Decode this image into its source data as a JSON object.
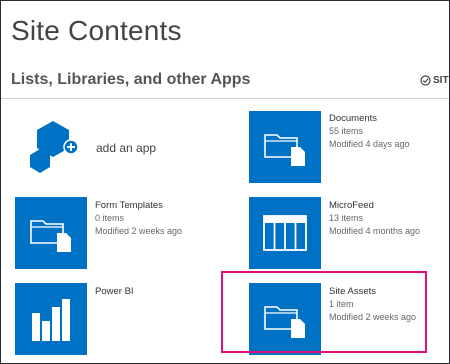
{
  "header": {
    "title": "Site Contents"
  },
  "section": {
    "title": "Lists, Libraries, and other Apps"
  },
  "settings": {
    "label": "SIT",
    "icon": "settings-check-icon"
  },
  "add_app": {
    "label": "add an app",
    "icon": "add-app-icon"
  },
  "apps": [
    {
      "name": "Documents",
      "items": "55 items",
      "modified": "Modified 4 days ago",
      "icon": "folder-document-icon"
    },
    {
      "name": "Form Templates",
      "items": "0 items",
      "modified": "Modified 2 weeks ago",
      "icon": "folder-document-icon"
    },
    {
      "name": "MicroFeed",
      "items": "13 items",
      "modified": "Modified 4 months ago",
      "icon": "list-table-icon"
    },
    {
      "name": "Power BI",
      "items": "",
      "modified": "",
      "icon": "bar-chart-icon"
    },
    {
      "name": "Site Assets",
      "items": "1 item",
      "modified": "Modified 2 weeks ago",
      "icon": "folder-document-icon"
    }
  ],
  "colors": {
    "tile": "#0072c6",
    "highlight": "#e0107a",
    "text": "#444444"
  }
}
